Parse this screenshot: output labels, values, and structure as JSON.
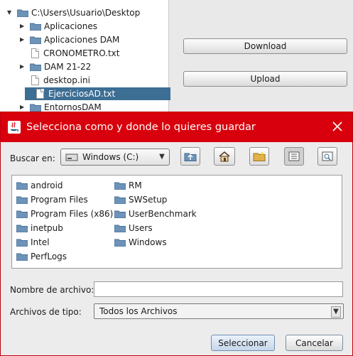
{
  "tree": {
    "root": "C:\\Users\\Usuario\\Desktop",
    "items": [
      {
        "label": "Aplicaciones",
        "kind": "folder",
        "expandable": true
      },
      {
        "label": "Aplicaciones DAM",
        "kind": "folder",
        "expandable": true
      },
      {
        "label": "CRONOMETRO.txt",
        "kind": "file",
        "expandable": false
      },
      {
        "label": "DAM 21-22",
        "kind": "folder",
        "expandable": true
      },
      {
        "label": "desktop.ini",
        "kind": "file",
        "expandable": false
      },
      {
        "label": "EjerciciosAD.txt",
        "kind": "file",
        "expandable": false,
        "selected": true
      },
      {
        "label": "EntornosDAM",
        "kind": "folder",
        "expandable": true
      }
    ]
  },
  "actions": {
    "download": "Download",
    "upload": "Upload"
  },
  "dialog": {
    "title": "Selecciona como y donde lo quieres guardar",
    "look_in_label": "Buscar en:",
    "look_in_value": "Windows (C:)",
    "files_col1": [
      "android",
      "Program Files",
      "Program Files (x86)",
      "inetpub",
      "Intel",
      "PerfLogs"
    ],
    "files_col2": [
      "RM",
      "SWSetup",
      "UserBenchmark",
      "Users",
      "Windows"
    ],
    "filename_label": "Nombre de archivo:",
    "filename_value": "",
    "filetype_label": "Archivos de tipo:",
    "filetype_value": "Todos los Archivos",
    "select_button": "Seleccionar",
    "cancel_button": "Cancelar"
  },
  "colors": {
    "titlebar": "#d8000c",
    "selection": "#3d6e94",
    "folder": "#6d93b8"
  }
}
